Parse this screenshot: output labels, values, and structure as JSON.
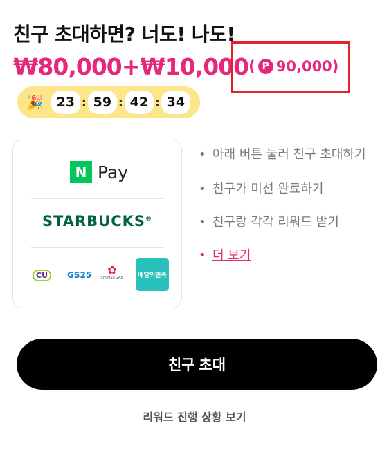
{
  "header": {
    "title": "친구 초대하면? 너도! 나도!",
    "amount_main": "₩80,000+₩10,000",
    "amount_total_open": "(",
    "point_symbol": "P",
    "amount_total": "90,000)"
  },
  "timer": {
    "icon": "party-popper-icon",
    "hours": "23",
    "minutes": "59",
    "seconds": "42",
    "centis": "34",
    "separator": ":"
  },
  "brands": {
    "npay_logo": "N",
    "npay_text": "Pay",
    "starbucks": "STARBUCKS",
    "starbucks_mark": "®",
    "cu": "CU",
    "gs25": "GS25",
    "shinsegae": "SHINSEGAE",
    "baemin": "배달의민족"
  },
  "steps": {
    "bullet": "•",
    "step1": "아래 버튼 눌러 친구 초대하기",
    "step2": "친구가 미션 완료하기",
    "step3": "친구랑 각각 리워드 받기",
    "more": "더 보기"
  },
  "actions": {
    "invite_button": "친구 초대",
    "progress_link": "리워드 진행 상황 보기"
  },
  "colors": {
    "accent": "#e6287d",
    "timer_bg": "#fde58a",
    "highlight_border": "#e32329",
    "button_bg": "#000000"
  }
}
